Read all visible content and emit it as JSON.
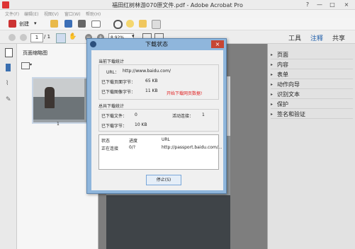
{
  "window": {
    "title": "福田红树林游070原文件.pdf - Adobe Acrobat Pro",
    "controls": [
      "?",
      "—",
      "□",
      "×"
    ]
  },
  "menu": [
    "文件(F)",
    "编辑(E)",
    "视图(V)",
    "窗口(W)",
    "帮助(H)"
  ],
  "toolbar": {
    "create_label": "创建",
    "page_current": "1",
    "page_total": "/ 1",
    "zoom": "8.92%",
    "tabs": [
      "工具",
      "注释",
      "共享"
    ]
  },
  "thumbnails": {
    "title": "页面缩略图",
    "page_label": "1"
  },
  "right_panel": {
    "items": [
      "页面",
      "内容",
      "表单",
      "动作向导",
      "识别文本",
      "保护",
      "签名和验证"
    ]
  },
  "dialog": {
    "title": "下载状态",
    "close": "×",
    "current_section": "当前下载统计",
    "url_label": "URL：",
    "url_value": "http://www.baidu.com/",
    "page_bytes_label": "已下载页面字节：",
    "page_bytes_value": "65 KB",
    "image_bytes_label": "已下载图像字节：",
    "image_bytes_value": "11 KB",
    "notice": "开始下载网页数据!",
    "total_section": "总共下载统计",
    "files_label": "已下载文件：",
    "files_value": "0",
    "active_label": "活动连接：",
    "active_value": "1",
    "total_bytes_label": "已下载字节：",
    "total_bytes_value": "10 KB",
    "table_headers": [
      "状态",
      "进度",
      "URL"
    ],
    "table_rows": [
      [
        "正在连接",
        "0/?",
        "http://passport.baidu.com/..."
      ]
    ],
    "stop_button": "停止(S)"
  },
  "colors": {
    "dialog_frame": "#8fb6dc",
    "notice_red": "#e02020",
    "close_red": "#c74634"
  }
}
